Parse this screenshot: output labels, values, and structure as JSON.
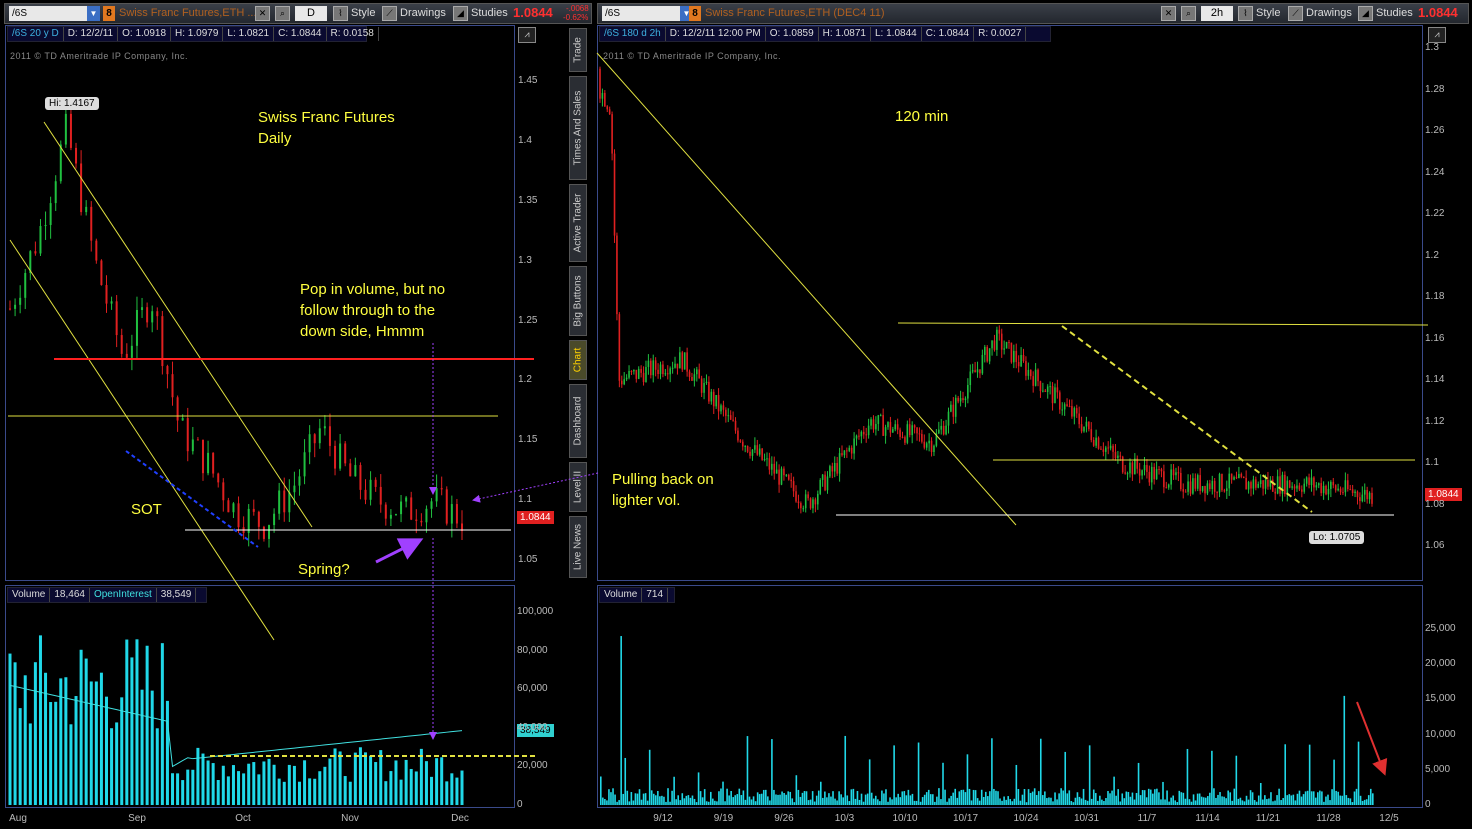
{
  "left": {
    "toolbar": {
      "symbol": "/6S",
      "badge": "8",
      "title": "Swiss Franc Futures,ETH ...",
      "timeframe": "D",
      "style": "Style",
      "drawings": "Drawings",
      "studies": "Studies",
      "price": "1.0844",
      "change": "-.0068",
      "change_pct": "-0.62%"
    },
    "header": {
      "study": "/6S 20 y D",
      "date": "D: 12/2/11",
      "open": "O: 1.0918",
      "high": "H: 1.0979",
      "low": "L: 1.0821",
      "close": "C: 1.0844",
      "range": "R: 0.0158"
    },
    "copyright": "2011 © TD Ameritrade IP Company, Inc.",
    "annotations": {
      "title1": "Swiss Franc Futures",
      "title2": "Daily",
      "note1": "Pop in volume, but no",
      "note2": "follow through to the",
      "note3": "down side, Hmmm",
      "sot": "SOT",
      "spring": "Spring?",
      "hi_label": "Hi: 1.4167",
      "price_tag": "1.0844",
      "oi_tag": "38,549"
    },
    "volume_header": {
      "label": "Volume",
      "volume": "18,464",
      "oi_label": "OpenInterest",
      "oi": "38,549"
    },
    "price_ticks": [
      "1.45",
      "1.4",
      "1.35",
      "1.3",
      "1.25",
      "1.2",
      "1.15",
      "1.1",
      "1.05"
    ],
    "volume_ticks": [
      "100,000",
      "80,000",
      "60,000",
      "40,000",
      "20,000",
      "0"
    ],
    "x_ticks": [
      "Aug",
      "Sep",
      "Oct",
      "Nov",
      "Dec"
    ]
  },
  "right": {
    "toolbar": {
      "symbol": "/6S",
      "badge": "8",
      "title": "Swiss Franc Futures,ETH (DEC4 11)",
      "timeframe": "2h",
      "style": "Style",
      "drawings": "Drawings",
      "studies": "Studies",
      "price": "1.0844"
    },
    "header": {
      "study": "/6S 180 d 2h",
      "date": "D: 12/2/11 12:00 PM",
      "open": "O: 1.0859",
      "high": "H: 1.0871",
      "low": "L: 1.0844",
      "close": "C: 1.0844",
      "range": "R: 0.0027"
    },
    "copyright": "2011 © TD Ameritrade IP Company, Inc.",
    "annotations": {
      "title": "120 min",
      "note1": "Pulling back on",
      "note2": "lighter vol.",
      "lo_label": "Lo: 1.0705",
      "price_tag": "1.0844"
    },
    "volume_header": {
      "label": "Volume",
      "volume": "714"
    },
    "price_ticks": [
      "1.3",
      "1.28",
      "1.26",
      "1.24",
      "1.22",
      "1.2",
      "1.18",
      "1.16",
      "1.14",
      "1.12",
      "1.1",
      "1.08",
      "1.06"
    ],
    "volume_ticks": [
      "25,000",
      "20,000",
      "15,000",
      "10,000",
      "5,000",
      "0"
    ],
    "x_ticks": [
      "9/12",
      "9/19",
      "9/26",
      "10/3",
      "10/10",
      "10/17",
      "10/24",
      "10/31",
      "11/7",
      "11/14",
      "11/21",
      "11/28",
      "12/5"
    ]
  },
  "side_tabs": [
    "Trade",
    "Times And Sales",
    "Active Trader",
    "Big Buttons",
    "Chart",
    "Dashboard",
    "Level II",
    "Live News"
  ],
  "chart_data": [
    {
      "type": "line",
      "ylim": [
        1.03,
        1.46
      ],
      "x": [
        "Aug",
        "Aug",
        "Aug",
        "Aug",
        "Sep",
        "Sep",
        "Sep",
        "Sep",
        "Oct",
        "Oct",
        "Oct",
        "Oct",
        "Nov",
        "Nov",
        "Nov",
        "Nov",
        "Dec"
      ],
      "series": [
        {
          "values": [
            1.26,
            1.32,
            1.41,
            1.3,
            1.22,
            1.27,
            1.16,
            1.13,
            1.09,
            1.08,
            1.11,
            1.16,
            1.12,
            1.1,
            1.09,
            1.1,
            1.0844
          ]
        }
      ],
      "volume": {
        "ylim": [
          0,
          100000
        ],
        "open_interest_end": 38549
      }
    },
    {
      "type": "line",
      "ylim": [
        1.04,
        1.31
      ],
      "x": [
        "9/12",
        "9/19",
        "9/26",
        "10/3",
        "10/10",
        "10/17",
        "10/24",
        "10/31",
        "11/7",
        "11/14",
        "11/21",
        "11/28",
        "12/5"
      ],
      "series": [
        {
          "values": [
            1.14,
            1.15,
            1.11,
            1.08,
            1.12,
            1.11,
            1.16,
            1.13,
            1.1,
            1.09,
            1.09,
            1.09,
            1.0844
          ]
        }
      ],
      "volume": {
        "ylim": [
          0,
          25000
        ]
      }
    }
  ]
}
